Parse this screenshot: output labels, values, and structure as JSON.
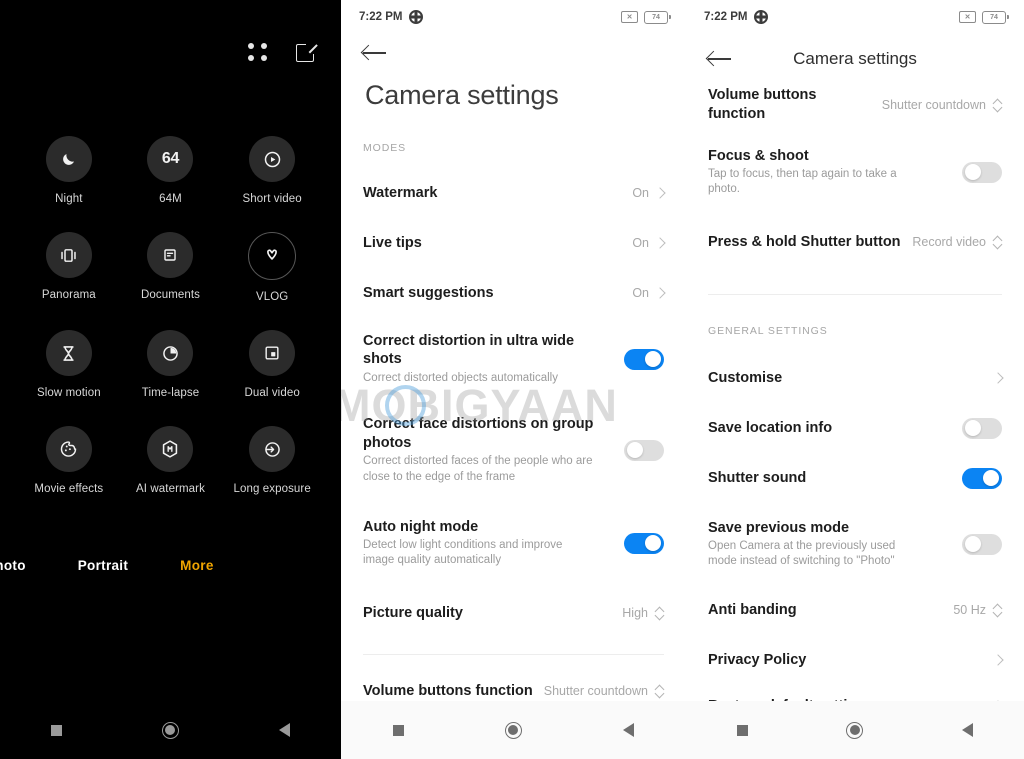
{
  "left_panel": {
    "topbar": {
      "grid_icon": "grid-four-dots-icon",
      "edit_icon": "edit-square-icon"
    },
    "modes": [
      {
        "label": "Night",
        "icon": "moon-icon"
      },
      {
        "label": "64M",
        "icon": "64-megapixel-icon",
        "text": "64"
      },
      {
        "label": "Short video",
        "icon": "play-circle-icon"
      },
      {
        "label": "Panorama",
        "icon": "panorama-icon"
      },
      {
        "label": "Documents",
        "icon": "document-icon"
      },
      {
        "label": "VLOG",
        "icon": "vlog-icon"
      },
      {
        "label": "Slow motion",
        "icon": "hourglass-icon"
      },
      {
        "label": "Time-lapse",
        "icon": "timelapse-clock-icon"
      },
      {
        "label": "Dual video",
        "icon": "dual-video-icon"
      },
      {
        "label": "Movie effects",
        "icon": "movie-effects-icon"
      },
      {
        "label": "AI watermark",
        "icon": "ai-watermark-hex-icon"
      },
      {
        "label": "Long exposure",
        "icon": "long-exposure-icon"
      }
    ],
    "mode_switcher": [
      {
        "label": "Photo",
        "active": false,
        "clipped": true
      },
      {
        "label": "Portrait",
        "active": false,
        "clipped": false
      },
      {
        "label": "More",
        "active": true,
        "clipped": false
      }
    ],
    "accent_color": "#f0a500",
    "navbar": {
      "recents": "recents-square-icon",
      "home": "home-circle-icon",
      "back": "back-triangle-icon"
    }
  },
  "middle_panel": {
    "statusbar": {
      "time": "7:22 PM",
      "gear_icon": "gear-icon",
      "mute_icon": "mute-icon",
      "battery_level": "74"
    },
    "back_icon": "back-arrow-icon",
    "title": "Camera settings",
    "section_modes": "MODES",
    "items": [
      {
        "title": "Watermark",
        "sub": "",
        "value": "On",
        "control": "chevron"
      },
      {
        "title": "Live tips",
        "sub": "",
        "value": "On",
        "control": "chevron"
      },
      {
        "title": "Smart suggestions",
        "sub": "",
        "value": "On",
        "control": "chevron"
      },
      {
        "title": "Correct distortion in ultra wide shots",
        "sub": "Correct distorted objects automatically",
        "value": "",
        "control": "toggle-on"
      },
      {
        "title": "Correct face distortions on group photos",
        "sub": "Correct distorted faces of the people who are close to the edge of the frame",
        "value": "",
        "control": "toggle-off"
      },
      {
        "title": "Auto night mode",
        "sub": "Detect low light conditions and improve image quality automatically",
        "value": "",
        "control": "toggle-on"
      },
      {
        "title": "Picture quality",
        "sub": "",
        "value": "High",
        "control": "updown"
      },
      {
        "title": "Volume buttons function",
        "sub": "",
        "value": "Shutter countdown",
        "control": "updown"
      }
    ],
    "navbar": {
      "recents": "recents-square-icon",
      "home": "home-circle-icon",
      "back": "back-triangle-icon"
    }
  },
  "right_panel": {
    "statusbar": {
      "time": "7:22 PM",
      "gear_icon": "gear-icon",
      "mute_icon": "mute-icon",
      "battery_level": "74"
    },
    "back_icon": "back-arrow-icon",
    "title": "Camera settings",
    "section_general": "GENERAL SETTINGS",
    "items_top": [
      {
        "title": "Volume buttons function",
        "sub": "",
        "value": "Shutter countdown",
        "control": "updown"
      },
      {
        "title": "Focus & shoot",
        "sub": "Tap to focus, then tap again to take a photo.",
        "value": "",
        "control": "toggle-off"
      },
      {
        "title": "Press & hold Shutter button",
        "sub": "",
        "value": "Record video",
        "control": "updown"
      }
    ],
    "items_general": [
      {
        "title": "Customise",
        "sub": "",
        "value": "",
        "control": "chevron"
      },
      {
        "title": "Save location info",
        "sub": "",
        "value": "",
        "control": "toggle-off"
      },
      {
        "title": "Shutter sound",
        "sub": "",
        "value": "",
        "control": "toggle-on"
      },
      {
        "title": "Save previous mode",
        "sub": "Open Camera at the previously used mode instead of switching to \"Photo\"",
        "value": "",
        "control": "toggle-off"
      },
      {
        "title": "Anti banding",
        "sub": "",
        "value": "50 Hz",
        "control": "updown"
      },
      {
        "title": "Privacy Policy",
        "sub": "",
        "value": "",
        "control": "chevron"
      },
      {
        "title": "Restore default settings",
        "sub": "",
        "value": "",
        "control": "chevron"
      }
    ],
    "navbar": {
      "recents": "recents-square-icon",
      "home": "home-circle-icon",
      "back": "back-triangle-icon"
    }
  },
  "watermark": {
    "text": "MOBIGYAAN"
  },
  "colors": {
    "toggle_on": "#0b84f3",
    "toggle_off": "#dedede",
    "accent": "#f0a500"
  }
}
